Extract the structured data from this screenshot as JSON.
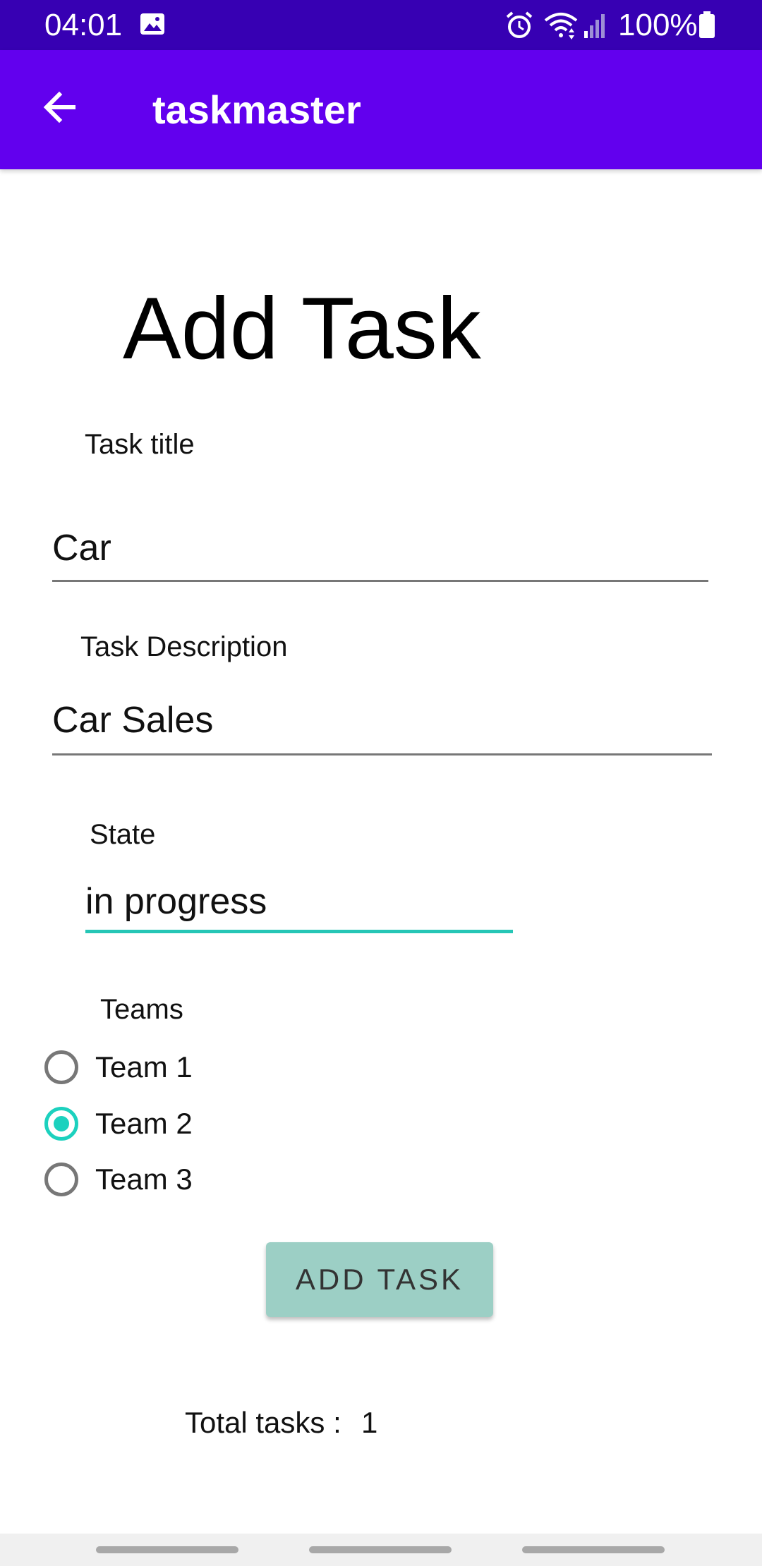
{
  "status_bar": {
    "time": "04:01",
    "battery": "100%",
    "icons": [
      "image-icon",
      "alarm-icon",
      "wifi-icon",
      "signal-icon",
      "battery-icon"
    ]
  },
  "app_bar": {
    "title": "taskmaster",
    "back_icon": "arrow-left-icon",
    "color": "#6200ee"
  },
  "form": {
    "heading": "Add Task",
    "title_label": "Task title",
    "title_value": "Car",
    "description_label": "Task Description",
    "description_value": "Car Sales",
    "state_label": "State",
    "state_value": "in progress",
    "teams_label": "Teams",
    "teams": [
      {
        "label": "Team 1",
        "checked": false
      },
      {
        "label": "Team 2",
        "checked": true
      },
      {
        "label": "Team 3",
        "checked": false
      }
    ],
    "submit_label": "ADD TASK"
  },
  "footer": {
    "total_label": "Total tasks :",
    "total_value": "1"
  },
  "colors": {
    "status_bar": "#3700b3",
    "accent": "#1cd1be",
    "button": "#9ccfc5"
  }
}
